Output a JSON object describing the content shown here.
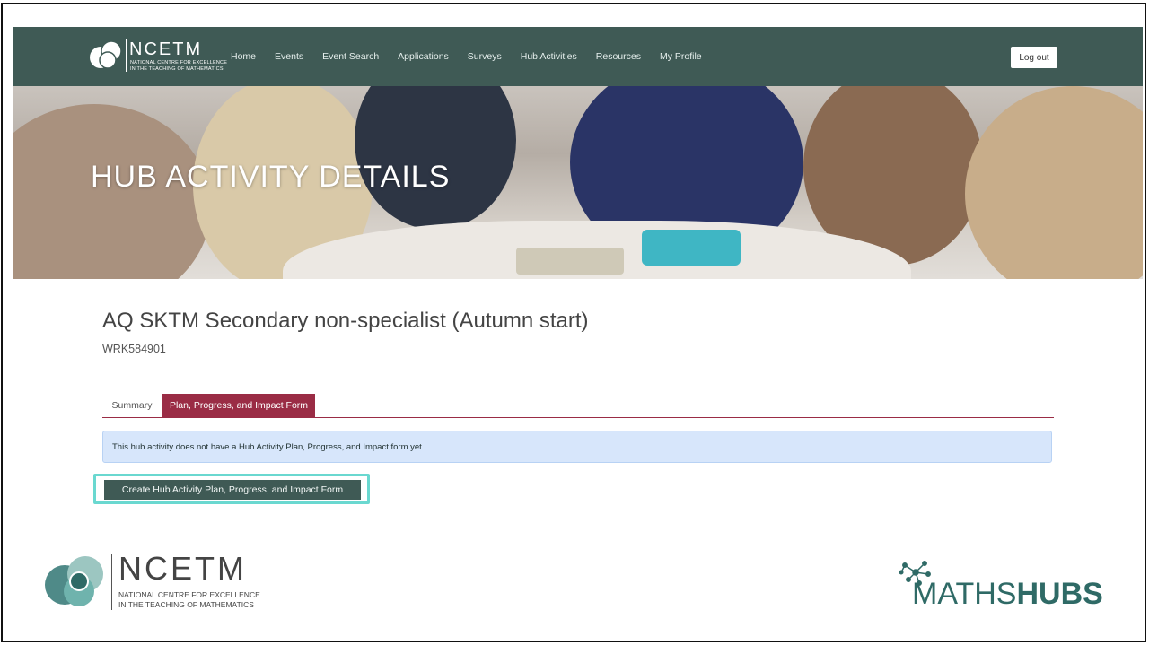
{
  "nav": {
    "brand": "NCETM",
    "brand_sub_1": "NATIONAL CENTRE FOR EXCELLENCE",
    "brand_sub_2": "IN THE TEACHING OF MATHEMATICS",
    "items": [
      {
        "label": "Home"
      },
      {
        "label": "Events"
      },
      {
        "label": "Event Search"
      },
      {
        "label": "Applications"
      },
      {
        "label": "Surveys"
      },
      {
        "label": "Hub Activities"
      },
      {
        "label": "Resources"
      },
      {
        "label": "My Profile"
      }
    ],
    "logout_label": "Log out"
  },
  "hero": {
    "title": "HUB ACTIVITY DETAILS"
  },
  "activity": {
    "title": "AQ SKTM Secondary non-specialist (Autumn start)",
    "code": "WRK584901"
  },
  "tabs": [
    {
      "label": "Summary"
    },
    {
      "label": "Plan, Progress, and Impact Form"
    }
  ],
  "alert": {
    "text": "This hub activity does not have a Hub Activity Plan, Progress, and Impact form yet."
  },
  "create_button": {
    "label": "Create Hub Activity Plan, Progress, and Impact Form"
  },
  "footer": {
    "ncetm_brand": "NCETM",
    "ncetm_sub_1": "NATIONAL CENTRE FOR EXCELLENCE",
    "ncetm_sub_2": "IN THE TEACHING OF MATHEMATICS",
    "mathshubs_light": "MATHS",
    "mathshubs_bold": "HUBS"
  },
  "colors": {
    "nav_bg": "#3f5a55",
    "accent_tab": "#9a2c45",
    "alert_bg": "#d7e6fb",
    "highlight": "#6ad8d0",
    "mathshubs": "#2f6a66"
  }
}
